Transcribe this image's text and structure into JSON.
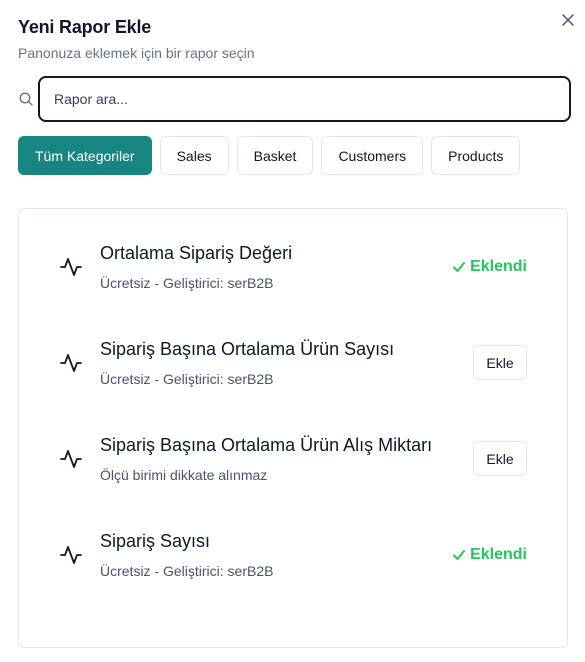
{
  "dialog": {
    "title": "Yeni Rapor Ekle",
    "subtitle": "Panonuza eklemek için bir rapor seçin",
    "close_icon": "close-icon"
  },
  "search": {
    "placeholder": "Rapor ara...",
    "value": "",
    "icon": "search-icon"
  },
  "categories": [
    {
      "label": "Tüm Kategoriler",
      "active": true
    },
    {
      "label": "Sales",
      "active": false
    },
    {
      "label": "Basket",
      "active": false
    },
    {
      "label": "Customers",
      "active": false
    },
    {
      "label": "Products",
      "active": false
    }
  ],
  "reports": [
    {
      "title": "Ortalama Sipariş Değeri",
      "subtitle": "Ücretsiz - Geliştirici: serB2B",
      "status": "added",
      "status_label": "Eklendi",
      "icon": "activity-icon"
    },
    {
      "title": "Sipariş Başına Ortalama Ürün Sayısı",
      "subtitle": "Ücretsiz - Geliştirici: serB2B",
      "status": "available",
      "button_label": "Ekle",
      "icon": "activity-icon"
    },
    {
      "title": "Sipariş Başına Ortalama Ürün Alış Miktarı",
      "subtitle": "Ölçü birimi dikkate alınmaz",
      "status": "available",
      "button_label": "Ekle",
      "icon": "activity-icon"
    },
    {
      "title": "Sipariş Sayısı",
      "subtitle": "Ücretsiz - Geliştirici: serB2B",
      "status": "added",
      "status_label": "Eklendi",
      "icon": "activity-icon"
    }
  ],
  "colors": {
    "accent": "#178683",
    "added": "#22c55e"
  }
}
